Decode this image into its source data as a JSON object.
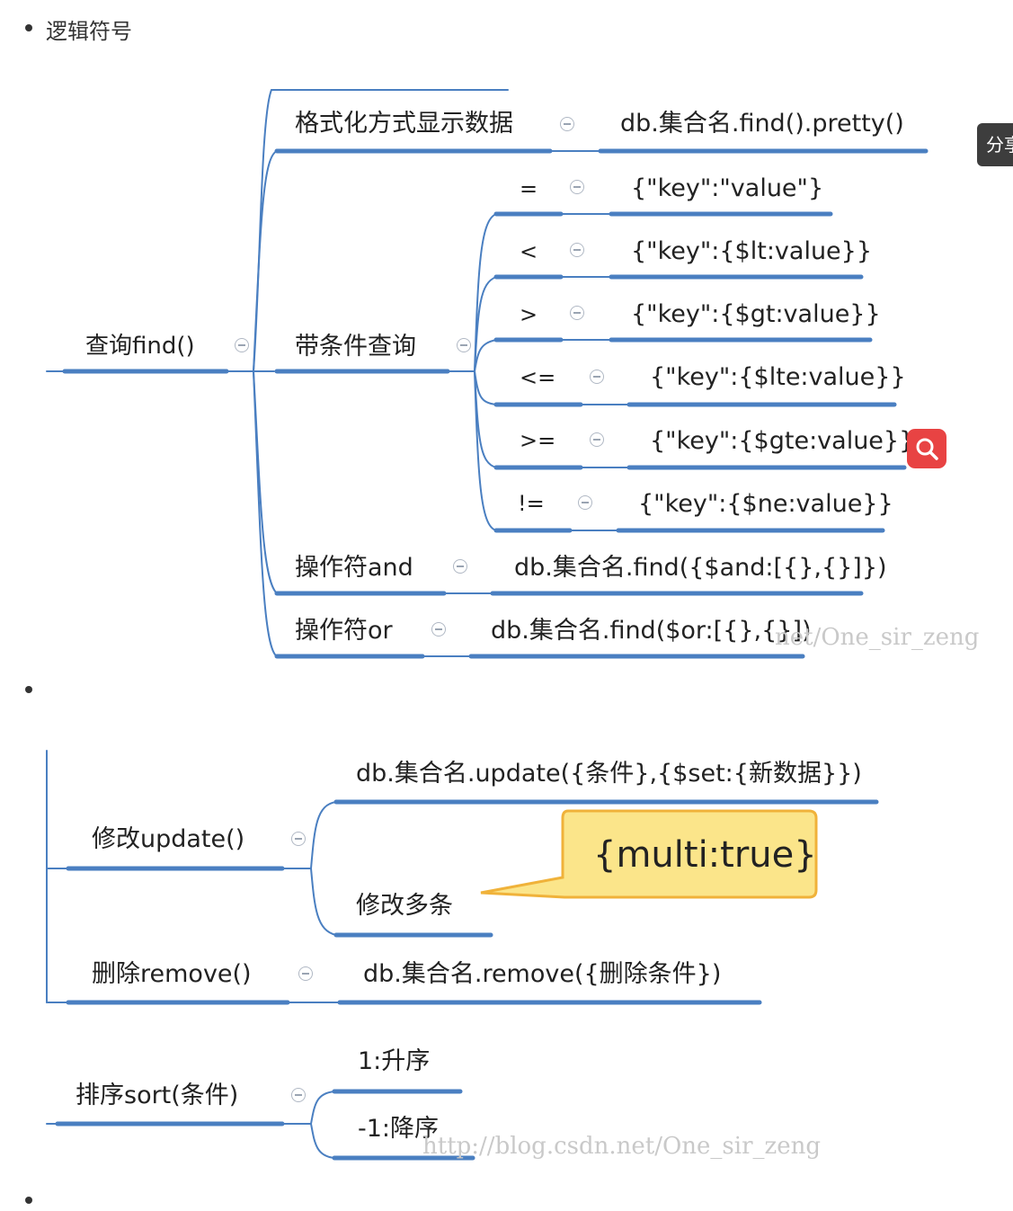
{
  "list": {
    "item1": "逻辑符号"
  },
  "find_map": {
    "root": "查询find()",
    "format_label": "格式化方式显示数据",
    "format_value": "db.集合名.find().pretty()",
    "cond_label": "带条件查询",
    "conditions": [
      {
        "op": "=",
        "value": "{\"key\":\"value\"}"
      },
      {
        "op": "<",
        "value": "{\"key\":{$lt:value}}"
      },
      {
        "op": ">",
        "value": "{\"key\":{$gt:value}}"
      },
      {
        "op": "<=",
        "value": "{\"key\":{$lte:value}}"
      },
      {
        "op": ">=",
        "value": "{\"key\":{$gte:value}}"
      },
      {
        "op": "!=",
        "value": "{\"key\":{$ne:value}}"
      }
    ],
    "and_label": "操作符and",
    "and_value": "db.集合名.find({$and:[{},{}]})",
    "or_label": "操作符or",
    "or_value": "db.集合名.find($or:[{},{}])",
    "watermark": "net/One_sir_zeng"
  },
  "update_map": {
    "update_root": "修改update()",
    "update_value": "db.集合名.update({条件},{$set:{新数据}})",
    "multi_label": "修改多条",
    "callout": "{multi:true}",
    "remove_root": "删除remove()",
    "remove_value": "db.集合名.remove({删除条件})"
  },
  "sort_map": {
    "root": "排序sort(条件)",
    "asc": "1:升序",
    "desc": "-1:降序",
    "watermark": "http://blog.csdn.net/One_sir_zeng"
  },
  "floating": {
    "share_label": "分享",
    "search_icon": "search-icon"
  },
  "colors": {
    "line": "#4a7fc1",
    "callout_fill": "#fbe58a",
    "callout_border": "#f0b23a",
    "search_bg": "#e84343",
    "share_bg": "#3d3d3d"
  }
}
